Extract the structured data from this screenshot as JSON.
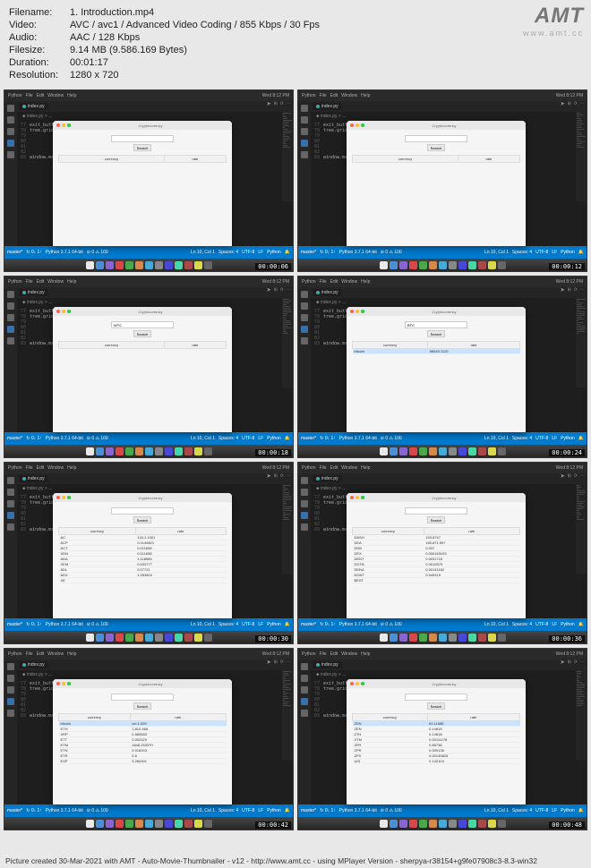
{
  "header": {
    "filename_label": "Filename:",
    "filename": "1. Introduction.mp4",
    "video_label": "Video:",
    "video": "AVC / avc1 / Advanced Video Coding / 855 Kbps / 30 Fps",
    "audio_label": "Audio:",
    "audio": "AAC / 128 Kbps",
    "filesize_label": "Filesize:",
    "filesize": "9.14 MB (9.586.169 Bytes)",
    "duration_label": "Duration:",
    "duration": "00:01:17",
    "resolution_label": "Resolution:",
    "resolution": "1280 x 720"
  },
  "logo": {
    "text": "AMT",
    "url": "www.amt.cc"
  },
  "menubar": {
    "items": [
      "Python",
      "File",
      "Edit",
      "Window",
      "Help"
    ],
    "right": "Wed 8:12 PM"
  },
  "tab": {
    "name": "index.py"
  },
  "breadcrumb": "index.py > ...",
  "code": {
    "lines": [
      {
        "num": "77",
        "text": "exit_button."
      },
      {
        "num": "78",
        "text": "tree.gridco"
      },
      {
        "num": "79",
        "text": ""
      },
      {
        "num": "80",
        "text": ""
      },
      {
        "num": "81",
        "text": ""
      },
      {
        "num": "82",
        "text": ""
      },
      {
        "num": "83",
        "text": "window.mainlo"
      }
    ]
  },
  "app": {
    "title": "Cryptocurrency",
    "search_label": "Search",
    "headers": [
      "currency",
      "rate"
    ]
  },
  "datasets": [
    {
      "query": "",
      "rows": []
    },
    {
      "query": "",
      "rows": []
    },
    {
      "query": "WTC",
      "rows": []
    },
    {
      "query": "BTC",
      "rows": [
        [
          "bitcoin",
          "56540.1120"
        ]
      ],
      "sel": 0
    },
    {
      "query": "",
      "rows": [
        [
          "AC",
          "143.1.1001"
        ],
        [
          "ACP",
          "0.0145821"
        ],
        [
          "ACT",
          "0.011658"
        ],
        [
          "XDN",
          "0.011658"
        ],
        [
          "ADA",
          "1.118589"
        ],
        [
          "XEM",
          "0.533777"
        ],
        [
          "ADL",
          "0.07721"
        ],
        [
          "ADX",
          "1.053804"
        ],
        [
          "XE",
          ""
        ]
      ]
    },
    {
      "query": "",
      "rows": [
        [
          "DASH",
          "193.8747"
        ],
        [
          "DEA",
          "165.871.597"
        ],
        [
          "DDB",
          "0.037"
        ],
        [
          "DEX",
          "0.000153193"
        ],
        [
          "DENT",
          "0.0031715"
        ],
        [
          "DGTB",
          "0.0019579"
        ],
        [
          "DENA",
          "0.00141182"
        ],
        [
          "DONT",
          "0.049319"
        ],
        [
          "BEST",
          ""
        ]
      ]
    },
    {
      "query": "",
      "rows": [
        [
          "bitcoin",
          "ver.1.539"
        ],
        [
          "ETH",
          "1,810.468"
        ],
        [
          "XRP",
          "0.565583"
        ],
        [
          "ETT",
          "0.002329"
        ],
        [
          "ETM",
          "1648.253370"
        ],
        [
          "ETN",
          "0.016003"
        ],
        [
          "ETR",
          "2.6"
        ],
        [
          "EXP",
          "3.260301"
        ]
      ],
      "sel": 0
    },
    {
      "query": "",
      "rows": [
        [
          "ZEN",
          "84.11686"
        ],
        [
          "ZEN",
          "0.14818"
        ],
        [
          "ZTH",
          "0.14818"
        ],
        [
          "XTM",
          "0.00111178"
        ],
        [
          "ZFR",
          "0.85738"
        ],
        [
          "ZPR",
          "0.000138"
        ],
        [
          "ZPX",
          "0.00145825"
        ],
        [
          "UIS",
          "0.142104"
        ]
      ],
      "sel": 0
    }
  ],
  "statusbar": {
    "branch": "master*",
    "sync": "↻ 0↓ 1↑",
    "python": "Python 3.7.1 64-bit",
    "errors": "⊘ 0 ⚠ 100",
    "position": "Ln 10, Col 1",
    "spaces": "Spaces: 4",
    "encoding": "UTF-8",
    "eol": "LF",
    "lang": "Python",
    "bell": "🔔"
  },
  "timestamps": [
    "00:00:06",
    "00:00:12",
    "00:00:18",
    "00:00:24",
    "00:00:30",
    "00:00:36",
    "00:00:42",
    "00:00:48"
  ],
  "dock_colors": [
    "#e8e8e8",
    "#4a8fd8",
    "#8866cc",
    "#d84848",
    "#4aa84a",
    "#d88848",
    "#48a8d8",
    "#888",
    "#4848d8",
    "#48d8a8",
    "#a84848",
    "#d8d848",
    "#666"
  ],
  "footer": "Picture created 30-Mar-2021 with AMT - Auto-Movie-Thumbnailer - v12 - http://www.amt.cc - using MPlayer Version - sherpya-r38154+g9fe07908c3-8.3-win32"
}
